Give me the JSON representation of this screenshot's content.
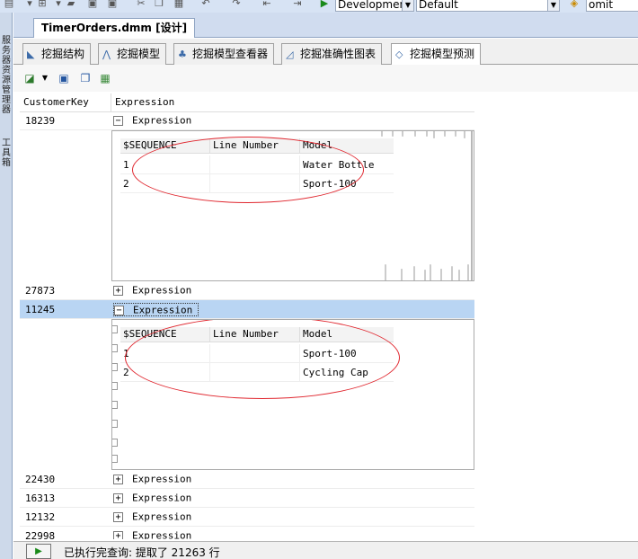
{
  "toolbar": {
    "config_combo": "Development",
    "platform_combo": "Default",
    "search_combo": "omit",
    "colors": {
      "bg": "#d7e3f4"
    }
  },
  "sidepanel": {
    "tab1": "服务器资源管理器",
    "tab2": "工具箱"
  },
  "document": {
    "tab_title": "TimerOrders.dmm [设计]"
  },
  "designer_tabs": [
    {
      "label": "挖掘结构",
      "icon": "structure-icon"
    },
    {
      "label": "挖掘模型",
      "icon": "model-icon"
    },
    {
      "label": "挖掘模型查看器",
      "icon": "viewer-icon"
    },
    {
      "label": "挖掘准确性图表",
      "icon": "chart-icon"
    },
    {
      "label": "挖掘模型预测",
      "icon": "prediction-icon"
    }
  ],
  "grid": {
    "columns": [
      "CustomerKey",
      "Expression"
    ],
    "rows": [
      {
        "key": "18239",
        "expr": "Expression",
        "expanded": true
      },
      {
        "key": "27873",
        "expr": "Expression",
        "expanded": false
      },
      {
        "key": "11245",
        "expr": "Expression",
        "expanded": true,
        "selected": true
      },
      {
        "key": "22430",
        "expr": "Expression",
        "expanded": false
      },
      {
        "key": "16313",
        "expr": "Expression",
        "expanded": false
      },
      {
        "key": "12132",
        "expr": "Expression",
        "expanded": false
      },
      {
        "key": "22998",
        "expr": "Expression",
        "expanded": false
      }
    ],
    "nested1": {
      "columns": [
        "$SEQUENCE",
        "Line Number",
        "Model"
      ],
      "rows": [
        [
          "1",
          "",
          "Water Bottle"
        ],
        [
          "2",
          "",
          "Sport-100"
        ]
      ]
    },
    "nested2": {
      "columns": [
        "$SEQUENCE",
        "Line Number",
        "Model"
      ],
      "rows": [
        [
          "1",
          "",
          "Sport-100"
        ],
        [
          "2",
          "",
          "Cycling Cap"
        ]
      ]
    },
    "highlight_color": "#e0262e"
  },
  "status": {
    "text": "已执行完查询: 提取了 21263 行"
  }
}
